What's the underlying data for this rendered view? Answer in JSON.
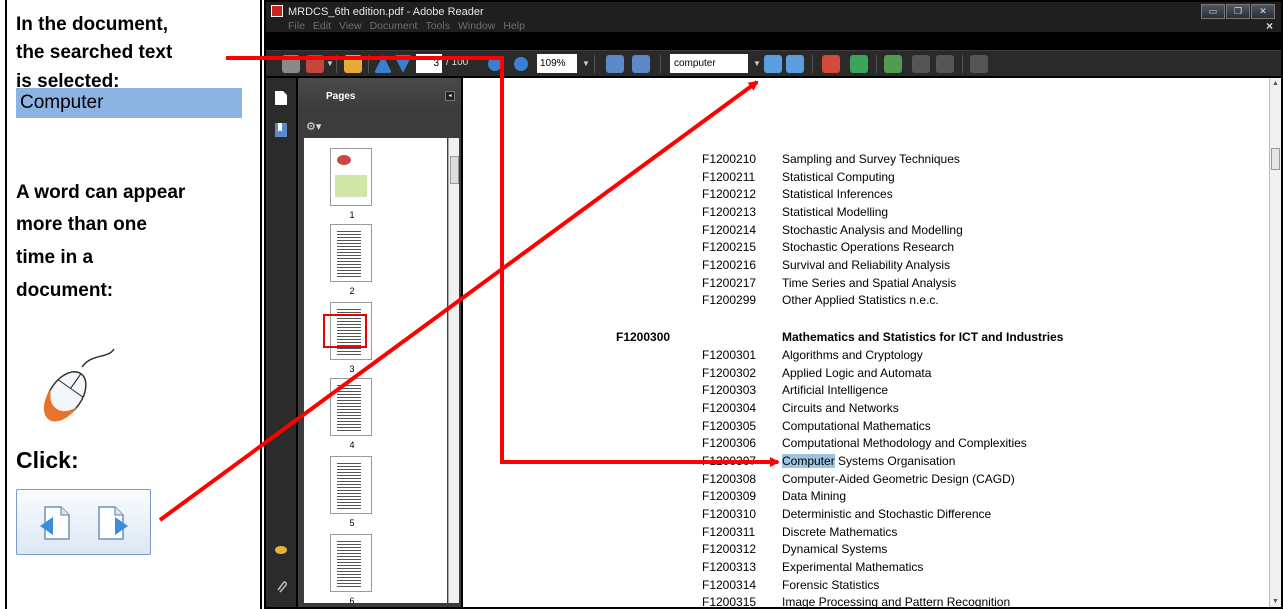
{
  "tutorial": {
    "line1": "In the document,",
    "line2": "the searched text",
    "line3": "is selected:",
    "selected_word": "Computer",
    "line4": "A word can appear",
    "line5": "more than one",
    "line6": "time in a",
    "line7": "document:",
    "click_label": "Click:"
  },
  "window": {
    "title": "MRDCS_6th edition.pdf - Adobe Reader",
    "menu": [
      "File",
      "Edit",
      "View",
      "Document",
      "Tools",
      "Window",
      "Help"
    ],
    "buttons": [
      "minimize",
      "maximize",
      "close"
    ]
  },
  "toolbar": {
    "page_number": "3",
    "page_total": "/ 100",
    "zoom": "109%",
    "search_value": "computer"
  },
  "pages_panel": {
    "title": "Pages",
    "thumbnails": [
      "1",
      "2",
      "3",
      "4",
      "5",
      "6"
    ]
  },
  "document": {
    "rows": [
      {
        "code": "F1200210",
        "label": "Sampling and Survey Techniques"
      },
      {
        "code": "F1200211",
        "label": "Statistical Computing"
      },
      {
        "code": "F1200212",
        "label": "Statistical Inferences"
      },
      {
        "code": "F1200213",
        "label": "Statistical Modelling"
      },
      {
        "code": "F1200214",
        "label": "Stochastic Analysis and Modelling"
      },
      {
        "code": "F1200215",
        "label": "Stochastic Operations Research"
      },
      {
        "code": "F1200216",
        "label": "Survival and Reliability Analysis"
      },
      {
        "code": "F1200217",
        "label": "Time Series and Spatial Analysis"
      },
      {
        "code": "F1200299",
        "label": "Other Applied Statistics n.e.c."
      }
    ],
    "heading": {
      "code": "F1200300",
      "label": "Mathematics and Statistics for ICT and Industries"
    },
    "rows2": [
      {
        "code": "F1200301",
        "label": "Algorithms and Cryptology"
      },
      {
        "code": "F1200302",
        "label": "Applied Logic and Automata"
      },
      {
        "code": "F1200303",
        "label": "Artificial Intelligence"
      },
      {
        "code": "F1200304",
        "label": "Circuits and Networks"
      },
      {
        "code": "F1200305",
        "label": "Computational Mathematics"
      },
      {
        "code": "F1200306",
        "label": "Computational Methodology and Complexities"
      },
      {
        "code": "F1200307",
        "label_highlight": "Computer",
        "label_rest": " Systems Organisation"
      },
      {
        "code": "F1200308",
        "label": "Computer-Aided Geometric Design (CAGD)"
      },
      {
        "code": "F1200309",
        "label": "Data Mining"
      },
      {
        "code": "F1200310",
        "label": "Deterministic and Stochastic Difference"
      },
      {
        "code": "F1200311",
        "label": "Discrete Mathematics"
      },
      {
        "code": "F1200312",
        "label": "Dynamical Systems"
      },
      {
        "code": "F1200313",
        "label": "Experimental Mathematics"
      },
      {
        "code": "F1200314",
        "label": "Forensic Statistics"
      },
      {
        "code": "F1200315",
        "label": "Image Processing and Pattern Recognition"
      }
    ]
  },
  "colors": {
    "highlight": "#9fc4e2",
    "selected_word_bg": "#8db3e2",
    "arrow": "#ff0000",
    "chrome_dark": "#2a2a2a"
  }
}
